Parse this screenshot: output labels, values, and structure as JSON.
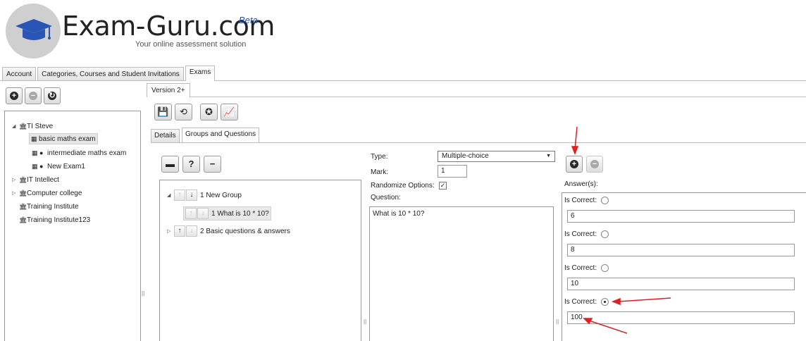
{
  "brand": {
    "name": "Exam-Guru.com",
    "badge": "Beta",
    "tagline": "Your online assessment solution"
  },
  "main_tabs": [
    "Account",
    "Categories, Courses and Student Invitations",
    "Exams"
  ],
  "left_tree": [
    {
      "label": "TI Steve",
      "expanded": true
    },
    {
      "label": "basic maths exam",
      "selected": true
    },
    {
      "label": "intermediate maths exam"
    },
    {
      "label": "New Exam1"
    },
    {
      "label": "IT Intellect"
    },
    {
      "label": "Computer college"
    },
    {
      "label": "Training Institute"
    },
    {
      "label": "Training Institute123"
    }
  ],
  "version_tab": "Version 2+",
  "sub_tabs": [
    "Details",
    "Groups and Questions"
  ],
  "groups": [
    {
      "label": "1 New Group"
    },
    {
      "label": "1 What is 10 * 10?"
    },
    {
      "label": "2 Basic questions & answers"
    }
  ],
  "form": {
    "type_label": "Type:",
    "type_value": "Multiple-choice",
    "mark_label": "Mark:",
    "mark_value": "1",
    "randomize_label": "Randomize Options:",
    "randomize_checked": true,
    "question_label": "Question:",
    "question_value": "What is 10 * 10?"
  },
  "answers": {
    "title": "Answer(s):",
    "is_correct_label": "Is Correct:",
    "items": [
      {
        "value": "6",
        "correct": false
      },
      {
        "value": "8",
        "correct": false
      },
      {
        "value": "10",
        "correct": false
      },
      {
        "value": "100",
        "correct": true
      }
    ]
  },
  "colors": {
    "annotation_arrow": "#e02020",
    "logo_cap": "#2a55b5"
  }
}
